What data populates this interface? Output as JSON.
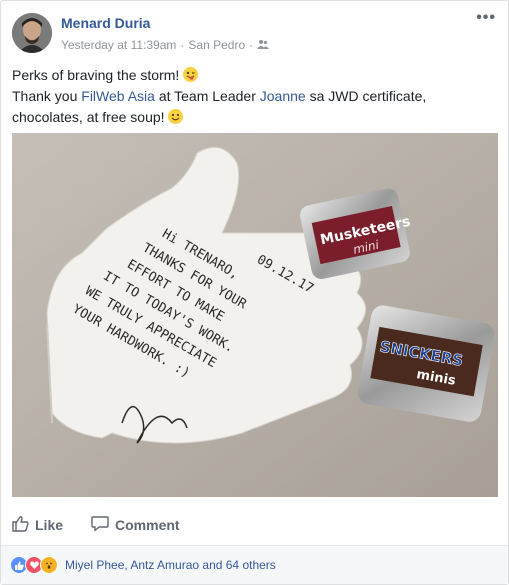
{
  "post": {
    "author": "Menard Duria",
    "timestamp": "Yesterday at 11:39am",
    "separator": "·",
    "location": "San Pedro",
    "more_label": "•••",
    "line1": "Perks of braving the storm!",
    "line2_a": "Thank you ",
    "line2_link1": "FilWeb Asia",
    "line2_b": " at Team Leader ",
    "line2_link2": "Joanne",
    "line2_c": " sa JWD certificate,",
    "line3": "chocolates, at free soup!"
  },
  "note": {
    "date": "09.12.17",
    "lines": [
      "Hi TRENARO,",
      "THANKS FOR YOUR",
      "EFFORT TO MAKE",
      "IT TO TODAY'S WORK.",
      "WE TRULY APPRECIATE",
      "YOUR HARDWORK. :)"
    ]
  },
  "candy": {
    "top_brand": "Musketeers",
    "top_sub": "mini",
    "bottom_brand": "SNICKERS",
    "bottom_sub": "minis"
  },
  "actions": {
    "like": "Like",
    "comment": "Comment"
  },
  "reactions": {
    "summary": "Miyel Phee, Antz Amurao and 64 others",
    "colors": {
      "like": "#5890ff",
      "love": "#f25268",
      "wow": "#f7b125"
    }
  }
}
